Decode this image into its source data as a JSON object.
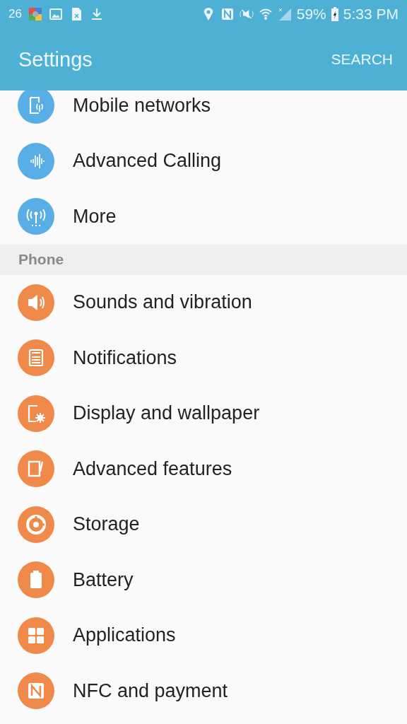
{
  "status_bar": {
    "notification_count": "26",
    "battery": "59%",
    "time": "5:33 PM"
  },
  "app_bar": {
    "title": "Settings",
    "action": "SEARCH"
  },
  "sections": [
    {
      "color": "#5aaee6",
      "items": [
        "Mobile networks",
        "Advanced Calling",
        "More"
      ]
    },
    {
      "header": "Phone",
      "color": "#f08a4b",
      "items": [
        "Sounds and vibration",
        "Notifications",
        "Display and wallpaper",
        "Advanced features",
        "Storage",
        "Battery",
        "Applications",
        "NFC and payment"
      ]
    }
  ]
}
